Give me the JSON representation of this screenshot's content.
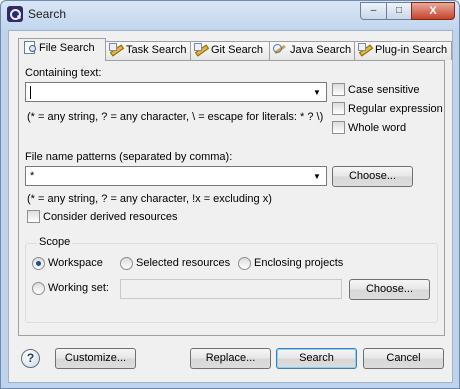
{
  "window": {
    "title": "Search",
    "minimize": "–",
    "maximize": "□",
    "close": "X"
  },
  "tabs": [
    {
      "label": "File Search",
      "icon": "file-search-icon",
      "active": true
    },
    {
      "label": "Task Search",
      "icon": "task-search-icon",
      "active": false
    },
    {
      "label": "Git Search",
      "icon": "git-search-icon",
      "active": false
    },
    {
      "label": "Java Search",
      "icon": "java-search-icon",
      "active": false
    },
    {
      "label": "Plug-in Search",
      "icon": "plugin-search-icon",
      "active": false
    }
  ],
  "file_search": {
    "containing_text_label": "Containing text:",
    "containing_text_value": "",
    "containing_hint": "(* = any string, ? = any character, \\ = escape for literals: * ? \\)",
    "case_sensitive": {
      "label": "Case sensitive",
      "checked": false
    },
    "regex": {
      "label": "Regular expression",
      "checked": false
    },
    "whole_word": {
      "label": "Whole word",
      "checked": false
    },
    "patterns_label": "File name patterns (separated by comma):",
    "patterns_value": "*",
    "choose_label": "Choose...",
    "patterns_hint": "(* = any string, ? = any character, !x = excluding x)",
    "derived": {
      "label": "Consider derived resources",
      "checked": false
    }
  },
  "scope": {
    "title": "Scope",
    "workspace": {
      "label": "Workspace",
      "selected": true
    },
    "selected_resources": {
      "label": "Selected resources",
      "selected": false
    },
    "enclosing_projects": {
      "label": "Enclosing projects",
      "selected": false
    },
    "working_set": {
      "label": "Working set:",
      "selected": false
    },
    "working_set_value": "",
    "choose_label": "Choose..."
  },
  "footer": {
    "help": "?",
    "customize": "Customize...",
    "replace": "Replace...",
    "search": "Search",
    "cancel": "Cancel"
  }
}
